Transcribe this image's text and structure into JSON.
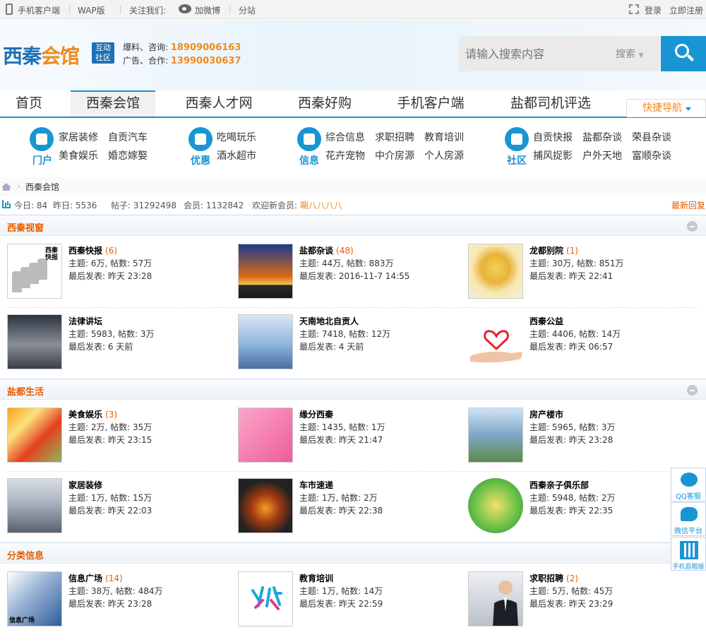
{
  "topbar": {
    "mobile_client": "手机客户端",
    "wap": "WAP版",
    "follow": "关注我们:",
    "weibo": "加微博",
    "substation": "分站",
    "login": "登录",
    "register": "立即注册"
  },
  "header": {
    "logo_text_a": "西秦",
    "logo_text_b": "会馆",
    "logo_badge": "互动社区",
    "contact_label_1": "爆料、咨询:",
    "contact_num_1": "18909006163",
    "contact_label_2": "广告、合作:",
    "contact_num_2": "13990030637",
    "search_placeholder": "请输入搜索内容",
    "search_select": "搜索"
  },
  "nav": {
    "items": [
      "首页",
      "西秦会馆",
      "西秦人才网",
      "西秦好购",
      "手机客户端",
      "盐都司机评选"
    ],
    "quick": "快捷导航"
  },
  "subnav": {
    "groups": [
      {
        "label": "门户",
        "links": [
          "家居装修",
          "自贡汽车",
          "美食娱乐",
          "婚恋嫁娶"
        ]
      },
      {
        "label": "优惠",
        "links": [
          "吃喝玩乐",
          "酒水超市"
        ]
      },
      {
        "label": "信息",
        "links": [
          "综合信息",
          "求职招聘",
          "教育培训",
          "花卉宠物",
          "中介房源",
          "个人房源"
        ]
      },
      {
        "label": "社区",
        "links": [
          "自贡快报",
          "盐都杂谈",
          "荣县杂谈",
          "捕风捉影",
          "户外天地",
          "富顺杂谈"
        ]
      }
    ]
  },
  "breadcrumb": {
    "current": "西秦会馆"
  },
  "stats": {
    "today_label": "今日:",
    "today": "84",
    "yesterday_label": "昨日:",
    "yesterday": "5536",
    "posts_label": "帖子:",
    "posts": "31292498",
    "members_label": "会员:",
    "members": "1132842",
    "welcome_label": "欢迎新会员:",
    "new_member": "唰八八八八",
    "latest": "最新回复"
  },
  "sections": [
    {
      "title": "西秦视窗",
      "forums": [
        {
          "name": "西秦快报",
          "new": "(6)",
          "stats": "主题: 6万, 帖数: 57万",
          "last": "最后发表: 昨天 23:28",
          "thumb_text": "西秦快报"
        },
        {
          "name": "盐都杂谈",
          "new": "(48)",
          "stats": "主题: 44万, 帖数: 883万",
          "last": "最后发表: 2016-11-7 14:55"
        },
        {
          "name": "龙都别院",
          "new": "(1)",
          "stats": "主题: 30万, 帖数: 851万",
          "last": "最后发表: 昨天 22:41"
        },
        {
          "name": "法律讲坛",
          "new": "",
          "stats": "主题: 5983, 帖数: 3万",
          "last": "最后发表: 6 天前"
        },
        {
          "name": "天南地北自贡人",
          "new": "",
          "stats": "主题: 7418, 帖数: 12万",
          "last": "最后发表: 4 天前"
        },
        {
          "name": "西秦公益",
          "new": "",
          "stats": "主题: 4406, 帖数: 14万",
          "last": "最后发表: 昨天 06:57"
        }
      ]
    },
    {
      "title": "盐都生活",
      "forums": [
        {
          "name": "美食娱乐",
          "new": "(3)",
          "stats": "主题: 2万, 帖数: 35万",
          "last": "最后发表: 昨天 23:15"
        },
        {
          "name": "缘分西秦",
          "new": "",
          "stats": "主题: 1435, 帖数: 1万",
          "last": "最后发表: 昨天 21:47"
        },
        {
          "name": "房产楼市",
          "new": "",
          "stats": "主题: 5965, 帖数: 3万",
          "last": "最后发表: 昨天 23:28"
        },
        {
          "name": "家居装修",
          "new": "",
          "stats": "主题: 1万, 帖数: 15万",
          "last": "最后发表: 昨天 22:03"
        },
        {
          "name": "车市速递",
          "new": "",
          "stats": "主题: 1万, 帖数: 2万",
          "last": "最后发表: 昨天 22:38"
        },
        {
          "name": "西秦亲子俱乐部",
          "new": "",
          "stats": "主题: 5948, 帖数: 2万",
          "last": "最后发表: 昨天 22:35"
        }
      ]
    },
    {
      "title": "分类信息",
      "forums": [
        {
          "name": "信息广场",
          "new": "(14)",
          "stats": "主题: 38万, 帖数: 484万",
          "last": "最后发表: 昨天 23:28",
          "thumb_text": "信息广场"
        },
        {
          "name": "教育培训",
          "new": "",
          "stats": "主题: 1万, 帖数: 14万",
          "last": "最后发表: 昨天 22:59"
        },
        {
          "name": "求职招聘",
          "new": "(2)",
          "stats": "主题: 5万, 帖数: 45万",
          "last": "最后发表: 昨天 23:29"
        }
      ]
    }
  ],
  "side_tools": [
    "QQ客服",
    "微信平台",
    "手机逛靓版"
  ],
  "colors": {
    "accent": "#1a95d3",
    "orange": "#e65c00",
    "brand": "#1f6fb6"
  }
}
